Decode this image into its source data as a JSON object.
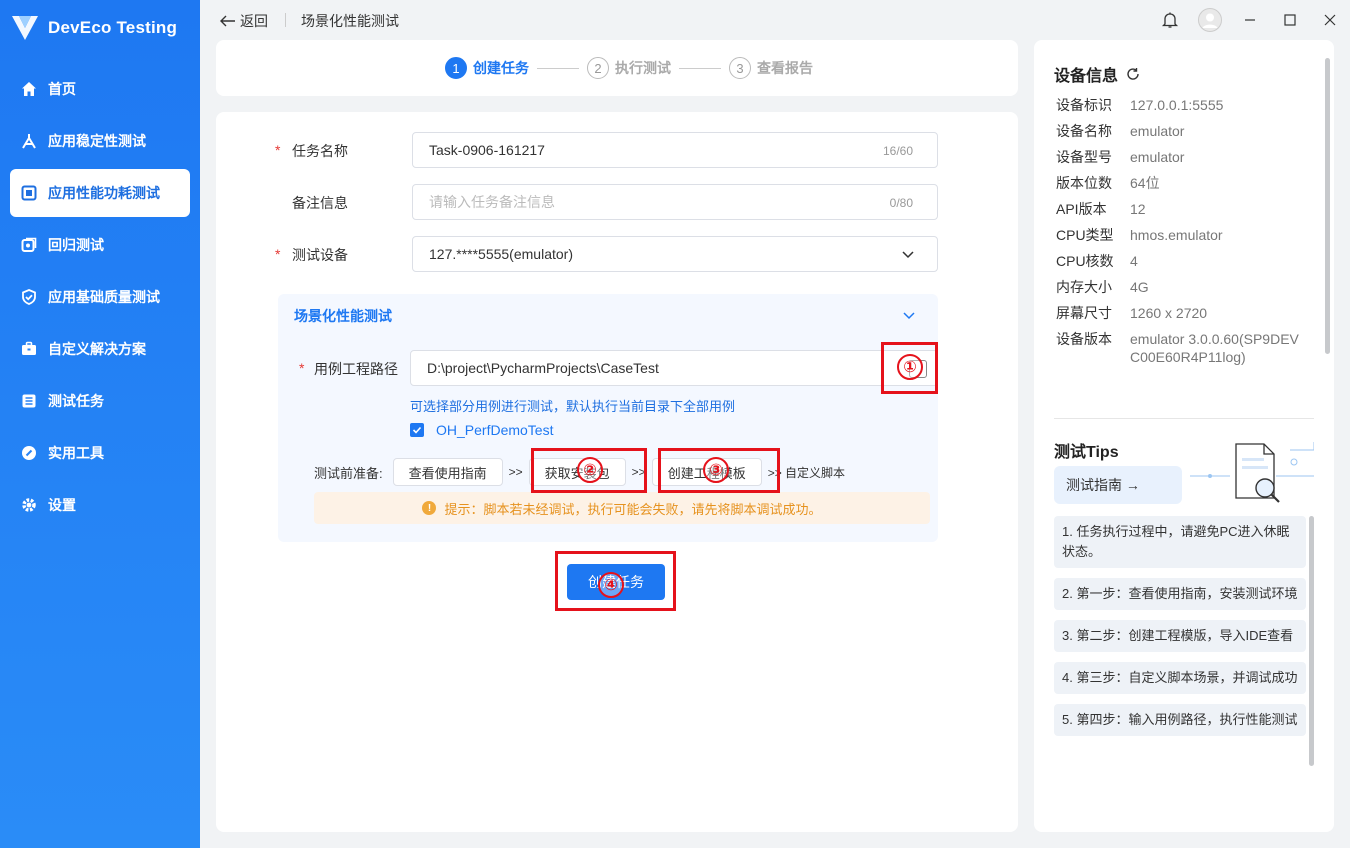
{
  "app": {
    "name": "DevEco Testing"
  },
  "sidebar": {
    "items": [
      {
        "label": "首页",
        "icon": "home-icon"
      },
      {
        "label": "应用稳定性测试",
        "icon": "stability-icon"
      },
      {
        "label": "应用性能功耗测试",
        "icon": "performance-icon",
        "active": true
      },
      {
        "label": "回归测试",
        "icon": "regression-icon"
      },
      {
        "label": "应用基础质量测试",
        "icon": "quality-icon"
      },
      {
        "label": "自定义解决方案",
        "icon": "briefcase-icon"
      },
      {
        "label": "测试任务",
        "icon": "task-list-icon"
      },
      {
        "label": "实用工具",
        "icon": "tool-icon"
      },
      {
        "label": "设置",
        "icon": "gear-icon"
      }
    ]
  },
  "titlebar": {
    "back_label": "返回",
    "page_title": "场景化性能测试"
  },
  "steps": [
    {
      "num": "1",
      "label": "创建任务",
      "active": true
    },
    {
      "num": "2",
      "label": "执行测试"
    },
    {
      "num": "3",
      "label": "查看报告"
    }
  ],
  "form": {
    "task_name": {
      "label": "任务名称",
      "value": "Task-0906-161217",
      "count": "16/60"
    },
    "remark": {
      "label": "备注信息",
      "placeholder": "请输入任务备注信息",
      "count": "0/80"
    },
    "device": {
      "label": "测试设备",
      "value": "127.****5555(emulator)"
    },
    "scene": {
      "title": "场景化性能测试",
      "path_label": "用例工程路径",
      "path_value": "D:\\project\\PycharmProjects\\CaseTest",
      "hint": "可选择部分用例进行测试，默认执行当前目录下全部用例",
      "case_name": "OH_PerfDemoTest",
      "prep_label": "测试前准备:",
      "btn_guide": "查看使用指南",
      "btn_install": "获取安装包",
      "btn_template": "创建工程模板",
      "arrow": ">>",
      "custom_script": ">> 自定义脚本",
      "tip": "提示：脚本若未经调试，执行可能会失败，请先将脚本调试成功。"
    },
    "create_label": "创建任务"
  },
  "annotations": [
    "①",
    "②",
    "③",
    "④"
  ],
  "device_info": {
    "title": "设备信息",
    "rows": [
      {
        "k": "设备标识",
        "v": "127.0.0.1:5555"
      },
      {
        "k": "设备名称",
        "v": "emulator"
      },
      {
        "k": "设备型号",
        "v": "emulator"
      },
      {
        "k": "版本位数",
        "v": "64位"
      },
      {
        "k": "API版本",
        "v": "12"
      },
      {
        "k": "CPU类型",
        "v": "hmos.emulator"
      },
      {
        "k": "CPU核数",
        "v": "4"
      },
      {
        "k": "内存大小",
        "v": "4G"
      },
      {
        "k": "屏幕尺寸",
        "v": "1260 x 2720"
      },
      {
        "k": "设备版本",
        "v": "emulator 3.0.0.60(SP9DEVC00E60R4P11log)"
      }
    ]
  },
  "tips": {
    "title": "测试Tips",
    "guide_label": "测试指南 →",
    "items": [
      "1. 任务执行过程中，请避免PC进入休眠状态。",
      "2. 第一步：查看使用指南，安装测试环境",
      "3. 第二步：创建工程模版，导入IDE查看",
      "4. 第三步：自定义脚本场景，并调试成功",
      "5. 第四步：输入用例路径，执行性能测试"
    ]
  },
  "colors": {
    "primary": "#1e78f2",
    "annotation": "#e5121b",
    "warning": "#e6921e"
  }
}
